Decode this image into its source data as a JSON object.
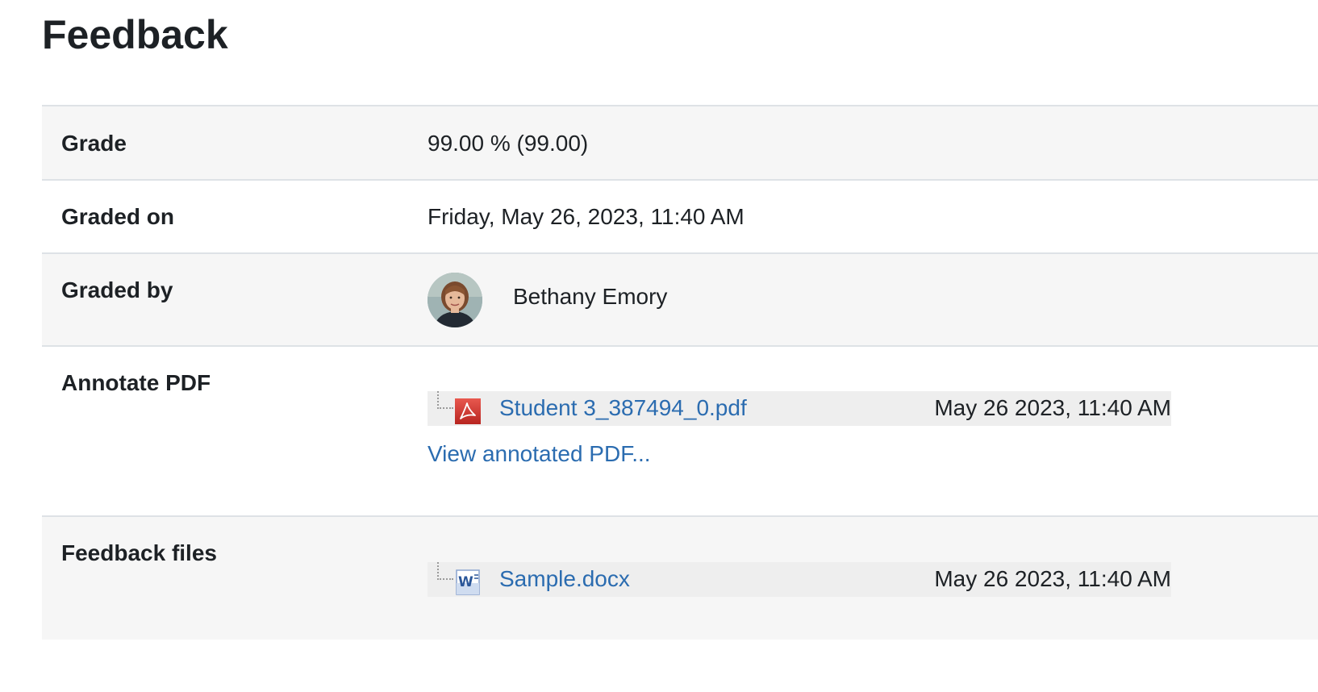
{
  "page": {
    "title": "Feedback"
  },
  "rows": {
    "grade": {
      "label": "Grade",
      "value": "99.00 % (99.00)"
    },
    "graded_on": {
      "label": "Graded on",
      "value": "Friday, May 26, 2023, 11:40 AM"
    },
    "graded_by": {
      "label": "Graded by",
      "name": "Bethany Emory",
      "avatar_icon": "user-avatar-photo"
    },
    "annotate_pdf": {
      "label": "Annotate PDF",
      "file": {
        "icon": "pdf-icon",
        "name": "Student 3_387494_0.pdf",
        "date": "May 26 2023, 11:40 AM"
      },
      "view_link": "View annotated PDF..."
    },
    "feedback_files": {
      "label": "Feedback files",
      "file": {
        "icon": "word-doc-icon",
        "name": "Sample.docx",
        "date": "May 26 2023, 11:40 AM"
      }
    }
  },
  "colors": {
    "link": "#2b6cb0",
    "row_shade": "#f6f6f6",
    "border": "#dee2e6",
    "pdf_red": "#d9312b",
    "word_blue": "#2a5699"
  }
}
